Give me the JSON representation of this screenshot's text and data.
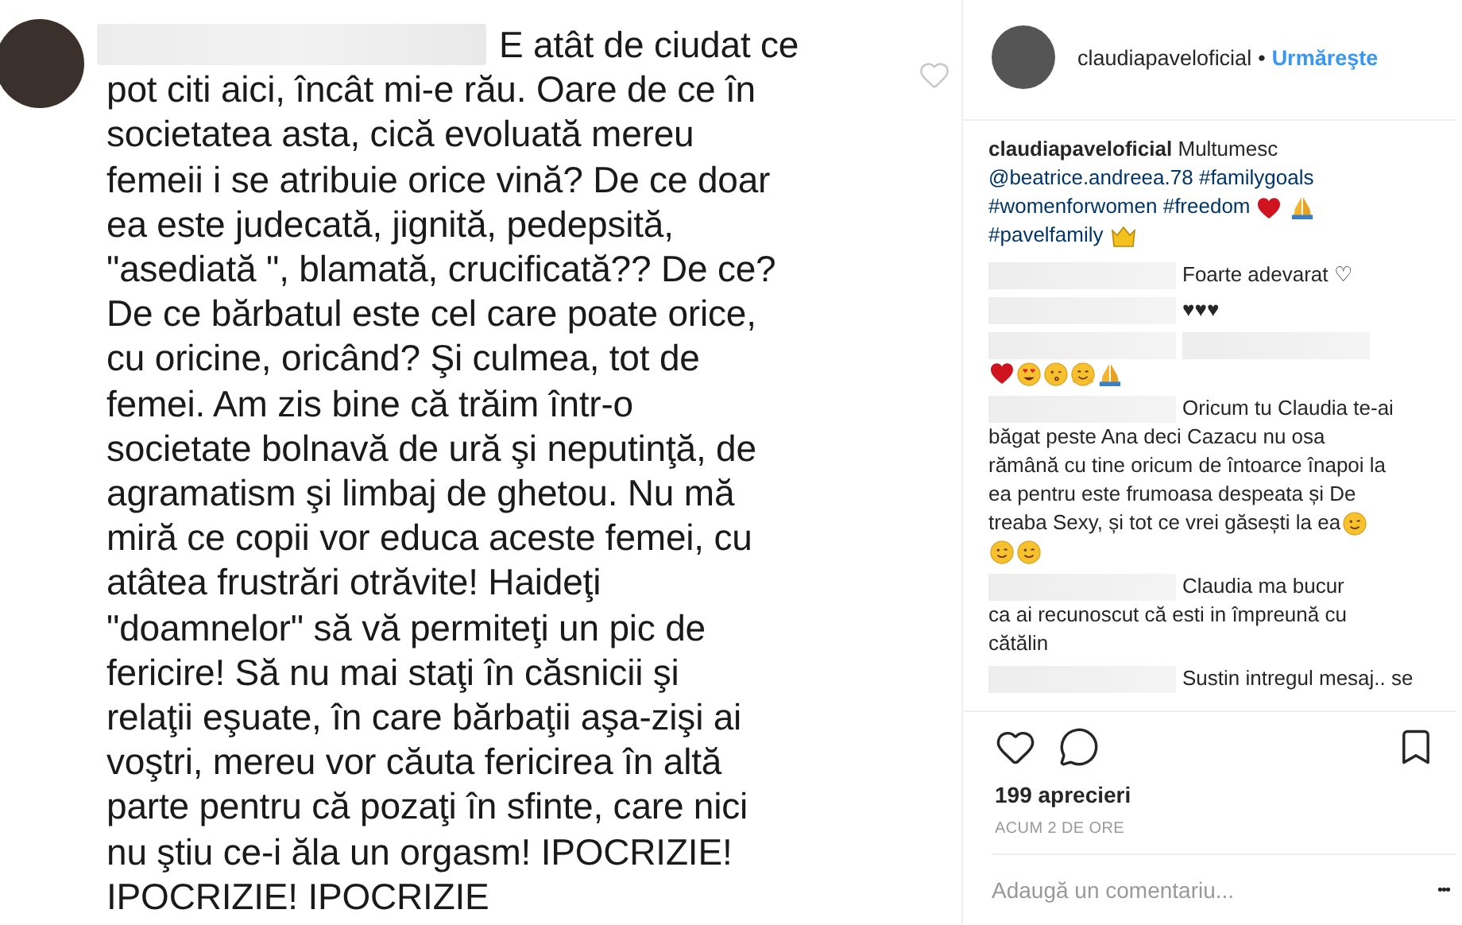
{
  "post_image": {
    "lines": [
      "E atât de ciudat ce",
      "pot citi aici, încât mi-e rău.  Oare de ce în",
      "societatea asta, cică evoluată mereu",
      "femeii i se atribuie orice vină? De ce doar",
      "ea este judecată, jignită, pedepsită,",
      "\"asediată \", blamată, crucificată?? De ce?",
      "De ce bărbatul este cel care poate orice,",
      "cu oricine, oricând? Şi culmea, tot de",
      "femei. Am zis bine că trăim într-o",
      "societate bolnavă de ură şi neputinţă, de",
      "agramatism şi limbaj de ghetou. Nu mă",
      "miră ce copii vor educa aceste femei, cu",
      "atâtea frustrări otrăvite! Haideţi",
      "\"doamnelor\" să vă permiteţi un pic de",
      "fericire! Să nu mai staţi în căsnicii şi",
      "relaţii eşuate, în care bărbaţii aşa-zişi ai",
      "voştri, mereu vor căuta fericirea în altă",
      "parte pentru că pozaţi în sfinte, care nici",
      "nu ştiu ce-i ăla un orgasm! IPOCRIZIE!",
      "IPOCRIZIE! IPOCRIZIE"
    ]
  },
  "header": {
    "username": "claudiapaveloficial",
    "separator": "•",
    "follow": "Urmăreşte"
  },
  "caption": [
    {
      "kind": "username",
      "text": "claudiapaveloficial"
    },
    {
      "kind": "text",
      "text": "Multumesc"
    },
    {
      "kind": "mention",
      "text": "@beatrice.andreea.78"
    },
    {
      "kind": "hashtag",
      "text": "#familygoals"
    },
    {
      "kind": "hashtag",
      "text": "#womenforwomen"
    },
    {
      "kind": "hashtag",
      "text": "#freedom"
    },
    {
      "kind": "heart"
    },
    {
      "kind": "pray"
    },
    {
      "kind": "hashtag",
      "text": "#pavelfamily"
    },
    {
      "kind": "crown"
    }
  ],
  "comments": [
    {
      "lines": [
        [
          {
            "kind": "blurred"
          },
          {
            "kind": "text",
            "text": "Foarte adevarat ♡"
          }
        ]
      ]
    },
    {
      "lines": [
        [
          {
            "kind": "blurred"
          },
          {
            "kind": "text",
            "text": "♥♥♥"
          }
        ]
      ]
    },
    {
      "lines": [
        [
          {
            "kind": "blurred"
          },
          {
            "kind": "blurred"
          }
        ],
        [
          {
            "kind": "heart"
          },
          {
            "kind": "heart-eyes"
          },
          {
            "kind": "kiss"
          },
          {
            "kind": "hug"
          },
          {
            "kind": "pray"
          }
        ]
      ]
    },
    {
      "lines": [
        [
          {
            "kind": "blurred"
          },
          {
            "kind": "text",
            "text": "Oricum tu Claudia te-ai"
          }
        ],
        [
          {
            "kind": "text",
            "text": "băgat peste Ana deci Cazacu nu osa"
          }
        ],
        [
          {
            "kind": "text",
            "text": "rămână cu tine oricum de întoarce înapoi la"
          }
        ],
        [
          {
            "kind": "text",
            "text": "ea pentru este frumoasa despeata și De"
          }
        ],
        [
          {
            "kind": "text",
            "text": "treaba Sexy, și tot ce vrei găsești la ea"
          },
          {
            "kind": "wink"
          }
        ],
        [
          {
            "kind": "wink"
          },
          {
            "kind": "wink"
          }
        ]
      ]
    },
    {
      "lines": [
        [
          {
            "kind": "blurred"
          },
          {
            "kind": "text",
            "text": "Claudia ma bucur"
          }
        ],
        [
          {
            "kind": "text",
            "text": "ca ai recunoscut că esti in împreună cu"
          }
        ],
        [
          {
            "kind": "text",
            "text": "cătălin"
          }
        ]
      ]
    },
    {
      "lines": [
        [
          {
            "kind": "blurred"
          },
          {
            "kind": "text",
            "text": "Sustin intregul mesaj.. se"
          }
        ]
      ]
    }
  ],
  "likes": "199 aprecieri",
  "time": "ACUM 2 DE ORE",
  "comment_field": {
    "placeholder": "Adaugă un comentariu..."
  },
  "more": "•••"
}
